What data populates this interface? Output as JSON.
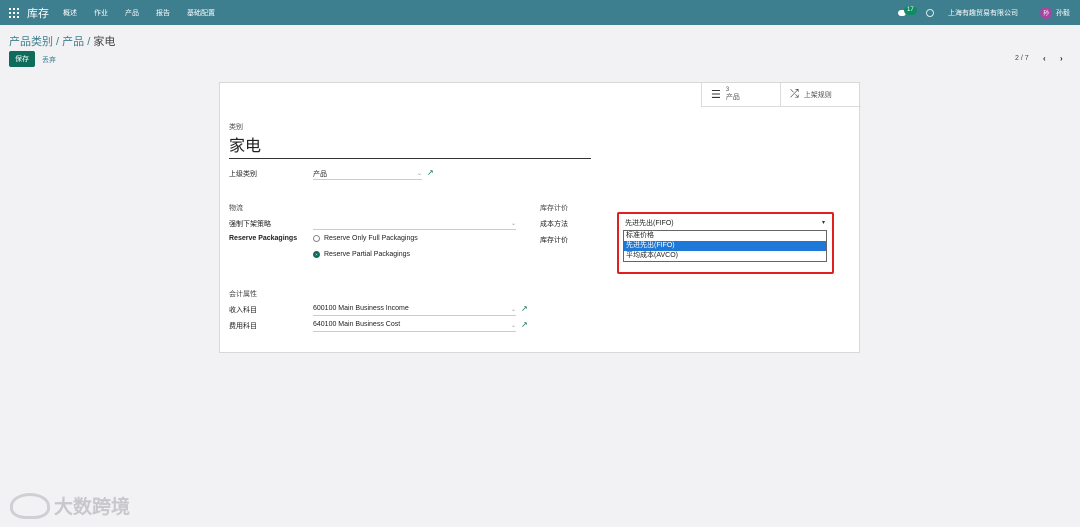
{
  "navbar": {
    "app_name": "库存",
    "menu": [
      "概述",
      "作业",
      "产品",
      "报告",
      "基础配置"
    ],
    "chat_count": "17",
    "company": "上海有趣贸易有限公司",
    "avatar_letter": "孙",
    "user": "孙毅"
  },
  "breadcrumb": {
    "path": "产品类别 / 产品 / 家电",
    "parent": "产品类别 / 产品 / ",
    "current": "家电"
  },
  "actions": {
    "save": "保存",
    "discard": "丢弃"
  },
  "pager": {
    "text": "2 / 7",
    "prev": "‹",
    "next": "›"
  },
  "stat_buttons": {
    "products": {
      "count": "3",
      "label": "产品"
    },
    "putaway": {
      "label": "上架规则"
    }
  },
  "form": {
    "category_label": "类别",
    "name": "家电",
    "parent_label": "上级类别",
    "parent_value": "产品",
    "logistics_header": "物流",
    "removal_label": "强制下架策略",
    "removal_value": "",
    "packaging_label": "Reserve Packagings",
    "packaging_options": [
      "Reserve Only Full Packagings",
      "Reserve Partial Packagings"
    ],
    "packaging_selected": 1,
    "valuation_header": "库存计价",
    "cost_method_label": "成本方法",
    "valuation_label": "库存计价",
    "cost_method_value": "先进先出(FIFO)",
    "cost_method_options": [
      "标准价格",
      "先进先出(FIFO)",
      "平均成本(AVCO)"
    ],
    "cost_method_selected": 1,
    "accounting_header": "会计属性",
    "income_label": "收入科目",
    "income_value": "600100 Main Business Income",
    "expense_label": "费用科目",
    "expense_value": "640100 Main Business Cost"
  },
  "watermark": "大数跨境",
  "colors": {
    "navbar": "#3d7e8f",
    "primary_button": "#0f6b5a",
    "highlight_border": "#e0201f",
    "selected_option": "#1e78d7"
  }
}
